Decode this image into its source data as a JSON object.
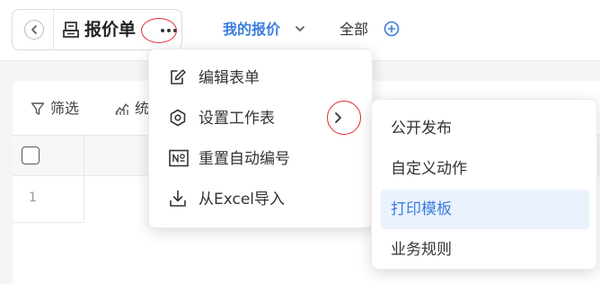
{
  "header": {
    "title": "报价单",
    "view_tab": "我的报价",
    "all_tab": "全部"
  },
  "toolbar": {
    "filter_label": "筛选",
    "stats_label": "统计"
  },
  "table": {
    "rows": [
      {
        "index": "1"
      }
    ]
  },
  "menu": {
    "items": [
      {
        "label": "编辑表单",
        "icon": "edit-icon"
      },
      {
        "label": "设置工作表",
        "icon": "hexagon-settings-icon"
      },
      {
        "label": "重置自动编号",
        "icon": "numero-icon"
      },
      {
        "label": "从Excel导入",
        "icon": "download-icon"
      }
    ]
  },
  "submenu": {
    "items": [
      {
        "label": "公开发布"
      },
      {
        "label": "自定义动作"
      },
      {
        "label": "打印模板",
        "active": true
      },
      {
        "label": "业务规则"
      }
    ]
  },
  "colors": {
    "accent": "#3b7ddd",
    "highlight": "#e0282e",
    "active_bg": "#eaf2fd"
  }
}
